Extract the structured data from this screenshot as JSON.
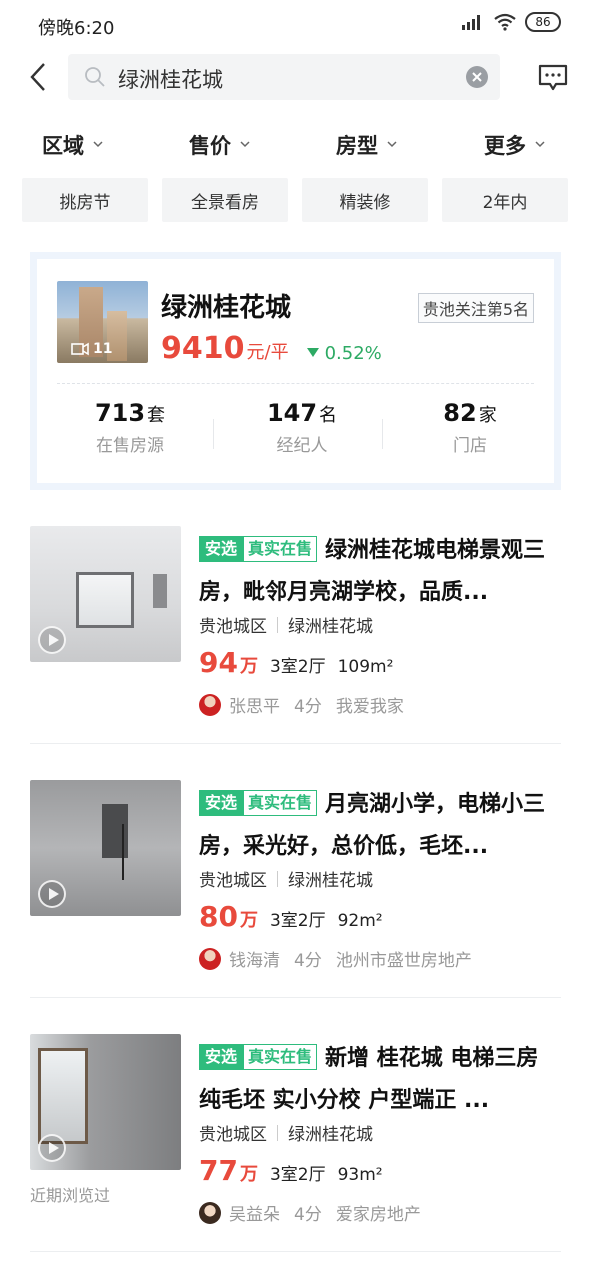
{
  "status": {
    "time": "傍晚6:20",
    "battery": "86"
  },
  "search": {
    "value": "绿洲桂花城"
  },
  "filters": [
    "区域",
    "售价",
    "房型",
    "更多"
  ],
  "tags": [
    "挑房节",
    "全景看房",
    "精装修",
    "2年内"
  ],
  "community": {
    "name": "绿洲桂花城",
    "rank": "贵池关注第5名",
    "photo_count": "11",
    "price": "9410",
    "price_unit": "元/平",
    "change": "0.52%",
    "stats": [
      {
        "num": "713",
        "unit": "套",
        "label": "在售房源"
      },
      {
        "num": "147",
        "unit": "名",
        "label": "经纪人"
      },
      {
        "num": "82",
        "unit": "家",
        "label": "门店"
      }
    ]
  },
  "badges": {
    "a": "安选",
    "b": "真实在售"
  },
  "listings": [
    {
      "title": "绿洲桂花城电梯景观三房，毗邻月亮湖学校，品质...",
      "district": "贵池城区",
      "community": "绿洲桂花城",
      "price": "94",
      "price_unit": "万",
      "rooms": "3室2厅",
      "area": "109m²",
      "agent": "张思平",
      "score": "4分",
      "agency": "我爱我家"
    },
    {
      "title": "月亮湖小学，电梯小三房，采光好，总价低，毛坯...",
      "district": "贵池城区",
      "community": "绿洲桂花城",
      "price": "80",
      "price_unit": "万",
      "rooms": "3室2厅",
      "area": "92m²",
      "agent": "钱海清",
      "score": "4分",
      "agency": "池州市盛世房地产"
    },
    {
      "title": "新增 桂花城 电梯三房 纯毛坯 实小分校 户型端正 ...",
      "district": "贵池城区",
      "community": "绿洲桂花城",
      "price": "77",
      "price_unit": "万",
      "rooms": "3室2厅",
      "area": "93m²",
      "agent": "吴益朵",
      "score": "4分",
      "agency": "爱家房地产",
      "recent": "近期浏览过"
    }
  ],
  "colors": {
    "accent_red": "#e84a3c",
    "accent_green": "#2ebc7d"
  }
}
